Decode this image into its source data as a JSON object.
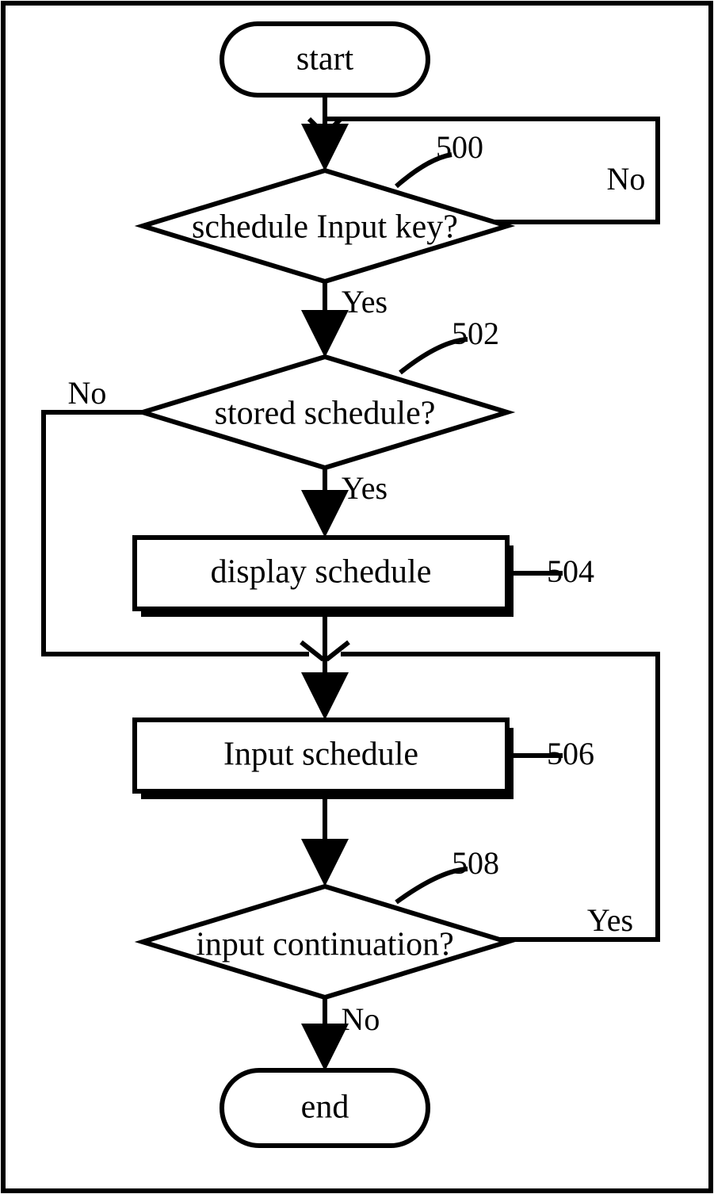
{
  "nodes": {
    "start": "start",
    "end": "end",
    "d500": "schedule Input key?",
    "d502": "stored schedule?",
    "p504": "display schedule",
    "p506": "Input schedule",
    "d508": "input continuation?"
  },
  "refs": {
    "r500": "500",
    "r502": "502",
    "r504": "504",
    "r506": "506",
    "r508": "508"
  },
  "labels": {
    "yes": "Yes",
    "no": "No"
  }
}
